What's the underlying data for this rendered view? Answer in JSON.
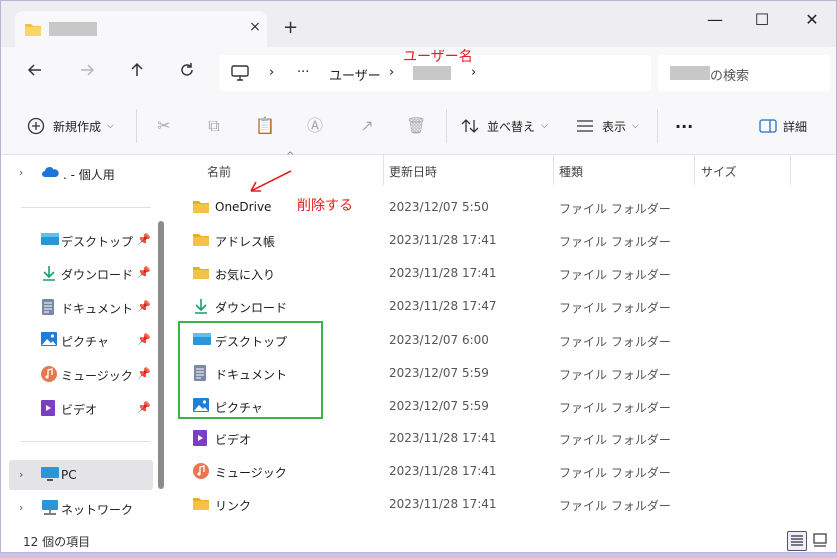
{
  "window": {
    "tab_title_hidden": true,
    "new_tab": "+",
    "close_tab": "×",
    "minimize": "—",
    "maximize": "☐",
    "close": "✕"
  },
  "nav": {
    "breadcrumb_more": "···",
    "breadcrumb_users": "ユーザー",
    "chevron": "›",
    "search_suffix": "の検索",
    "annotation_username": "ユーザー名"
  },
  "toolbar": {
    "new": "新規作成",
    "sort": "並べ替え",
    "view": "表示",
    "more": "···",
    "details": "詳細"
  },
  "sidebar": {
    "items": [
      {
        "label": ". - 個人用",
        "icon": "onedrive-icon"
      },
      {
        "label": "デスクトップ",
        "icon": "desktop-icon"
      },
      {
        "label": "ダウンロード",
        "icon": "download-icon"
      },
      {
        "label": "ドキュメント",
        "icon": "document-icon"
      },
      {
        "label": "ピクチャ",
        "icon": "pictures-icon"
      },
      {
        "label": "ミュージック",
        "icon": "music-icon"
      },
      {
        "label": "ビデオ",
        "icon": "video-icon"
      },
      {
        "label": "PC",
        "icon": "pc-icon"
      },
      {
        "label": "ネットワーク",
        "icon": "network-icon"
      }
    ]
  },
  "columns": {
    "name": "名前",
    "date": "更新日時",
    "type": "種類",
    "size": "サイズ"
  },
  "files": [
    {
      "name": "OneDrive",
      "date": "2023/12/07 5:50",
      "type": "ファイル フォルダー",
      "icon": "folder-icon"
    },
    {
      "name": "アドレス帳",
      "date": "2023/11/28 17:41",
      "type": "ファイル フォルダー",
      "icon": "folder-icon"
    },
    {
      "name": "お気に入り",
      "date": "2023/11/28 17:41",
      "type": "ファイル フォルダー",
      "icon": "folder-icon"
    },
    {
      "name": "ダウンロード",
      "date": "2023/11/28 17:47",
      "type": "ファイル フォルダー",
      "icon": "download-icon"
    },
    {
      "name": "デスクトップ",
      "date": "2023/12/07 6:00",
      "type": "ファイル フォルダー",
      "icon": "desktop-icon"
    },
    {
      "name": "ドキュメント",
      "date": "2023/12/07 5:59",
      "type": "ファイル フォルダー",
      "icon": "document-icon"
    },
    {
      "name": "ピクチャ",
      "date": "2023/12/07 5:59",
      "type": "ファイル フォルダー",
      "icon": "pictures-icon"
    },
    {
      "name": "ビデオ",
      "date": "2023/11/28 17:41",
      "type": "ファイル フォルダー",
      "icon": "video-icon"
    },
    {
      "name": "ミュージック",
      "date": "2023/11/28 17:41",
      "type": "ファイル フォルダー",
      "icon": "music-icon"
    },
    {
      "name": "リンク",
      "date": "2023/11/28 17:41",
      "type": "ファイル フォルダー",
      "icon": "folder-icon"
    }
  ],
  "annotation_delete": "削除する",
  "status": {
    "item_count": "12 個の項目"
  },
  "colors": {
    "annotation_red": "#e02020",
    "highlight_green": "#3cb34a",
    "folder_yellow": "#f3c348",
    "desktop_blue": "#2b95d8"
  }
}
